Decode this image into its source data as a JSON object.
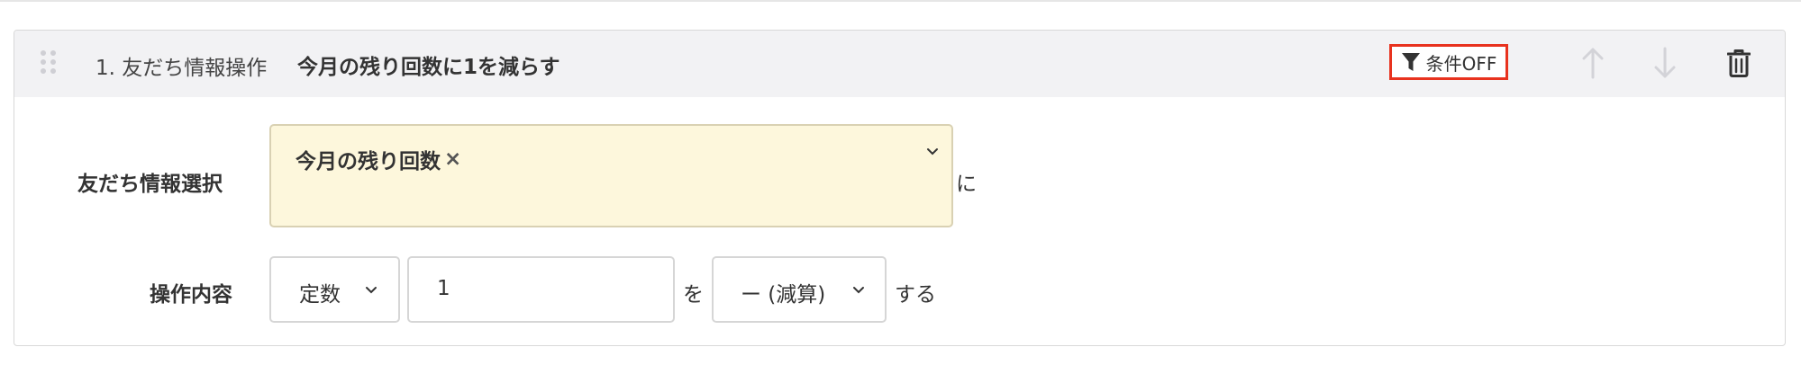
{
  "step": {
    "label": "1. 友だち情報操作",
    "title": "今月の残り回数に1を減らす"
  },
  "header_actions": {
    "condition_button": "条件OFF",
    "icons": [
      "filter-icon",
      "arrow-up-icon",
      "arrow-down-icon",
      "trash-icon"
    ]
  },
  "friend_info_row": {
    "label": "友だち情報選択",
    "selected_tag": "今月の残り回数",
    "tag_remove": "×",
    "suffix": "に"
  },
  "operation_row": {
    "label": "操作内容",
    "type_select": "定数",
    "value_input": "1",
    "particle": "を",
    "op_select": "ー (減算)",
    "suffix": "する"
  },
  "colors": {
    "header_bg": "#f2f2f4",
    "highlight_border": "#e8321e",
    "select_bg": "#fdf7dc"
  }
}
